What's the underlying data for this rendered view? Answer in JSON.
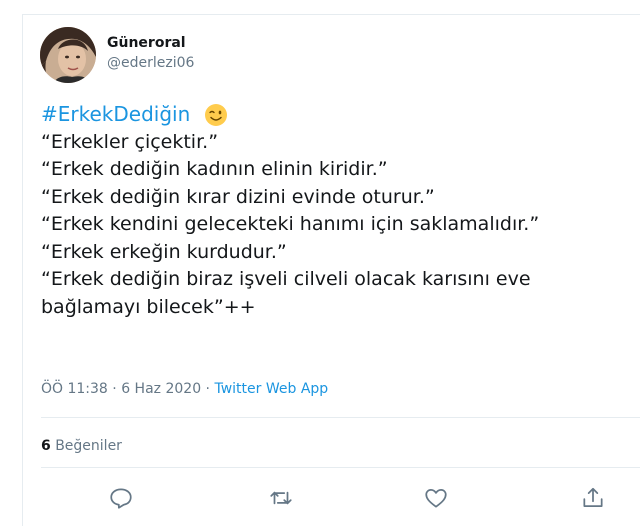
{
  "user": {
    "display_name": "Güneroral",
    "handle": "@ederlezi06"
  },
  "tweet": {
    "hashtag": "#ErkekDediğin",
    "emoji": "winking-face-icon",
    "lines": [
      "“Erkekler çiçektir.”",
      "“Erkek dediğin kadının elinin kiridir.”",
      "“Erkek dediğin kırar dizini evinde oturur.”",
      "“Erkek kendini gelecekteki hanımı için saklamalıdır.”",
      "“Erkek erkeğin kurdudur.”",
      "“Erkek dediğin biraz işveli cilveli olacak karısını eve",
      "bağlamayı bilecek”++"
    ]
  },
  "meta": {
    "time": "ÖÖ 11:38",
    "date": "6 Haz 2020",
    "separator": " · ",
    "app": "Twitter Web App"
  },
  "stats": {
    "likes_count": "6",
    "likes_label": "Beğeniler"
  },
  "actions": [
    "reply-icon",
    "retweet-icon",
    "like-icon",
    "share-icon"
  ],
  "colors": {
    "link": "#1b95e0",
    "secondary_text": "#657786",
    "primary_text": "#14171a",
    "divider": "#e6ecf0"
  }
}
